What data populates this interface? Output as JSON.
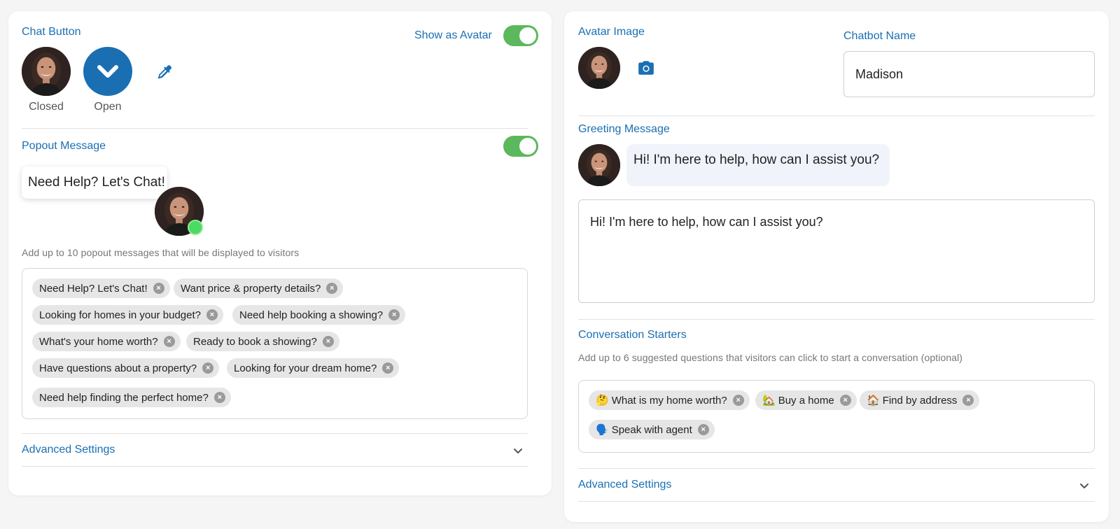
{
  "chat_button": {
    "label": "Chat Button",
    "show_as_avatar_label": "Show as Avatar",
    "closed_label": "Closed",
    "open_label": "Open",
    "open_icon": "chevron-down-icon",
    "picker_icon": "eyedropper-icon"
  },
  "popout": {
    "label": "Popout Message",
    "preview_text": "Need Help? Let's Chat!",
    "hint": "Add up to 10 popout messages that will be displayed to visitors",
    "chips": [
      "Need Help? Let's Chat!",
      "Want price & property details?",
      "Looking for homes in your budget?",
      "Need help booking a showing?",
      "What's your home worth?",
      "Ready to book a showing?",
      "Have questions about a property?",
      "Looking for your dream home?",
      "Need help finding the perfect home?"
    ],
    "advanced_label": "Advanced Settings"
  },
  "avatar": {
    "label": "Avatar Image",
    "camera_icon": "camera-icon"
  },
  "chatbot_name": {
    "label": "Chatbot Name",
    "value": "Madison"
  },
  "greeting": {
    "label": "Greeting Message",
    "preview": "Hi! I'm here to help, how can I assist you?",
    "value": "Hi! I'm here to help, how can I assist you?"
  },
  "starters": {
    "label": "Conversation Starters",
    "hint": "Add up to 6 suggested questions that visitors can click to start a conversation (optional)",
    "chips": [
      {
        "emoji": "🤔",
        "text": "What is my home worth?"
      },
      {
        "emoji": "🏡",
        "text": "Buy a home"
      },
      {
        "emoji": "🏠",
        "text": "Find by address"
      },
      {
        "emoji": "🗣️",
        "text": "Speak with agent"
      }
    ],
    "advanced_label": "Advanced Settings"
  },
  "colors": {
    "accent": "#1a6fb3",
    "toggle_on": "#5cb85c",
    "online": "#4cd964"
  }
}
